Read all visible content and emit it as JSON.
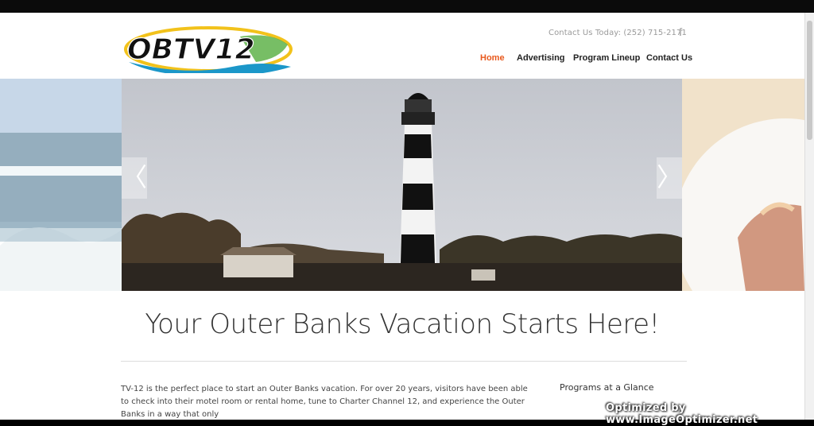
{
  "header": {
    "logo_text": "OBTV12",
    "contact_text": "Contact Us Today: (252) 715-2171",
    "facebook_icon": "facebook-icon",
    "nav": [
      {
        "label": "Home",
        "active": true
      },
      {
        "label": "Advertising",
        "active": false
      },
      {
        "label": "Program Lineup",
        "active": false
      },
      {
        "label": "Contact Us",
        "active": false
      }
    ]
  },
  "slider": {
    "prev_icon": "chevron-left-icon",
    "next_icon": "chevron-right-icon",
    "prev_glyph": "〈",
    "next_glyph": "〉"
  },
  "main": {
    "headline": "Your Outer Banks Vacation Starts Here!",
    "intro": "TV-12 is the perfect place to start an Outer Banks vacation. For over 20 years, visitors have been able to check into their motel room or rental home, tune to Charter Channel 12, and experience the Outer Banks in a way that only",
    "sidebar_title": "Programs at a Glance"
  },
  "watermark": "Optimized by www.ImageOptimizer.net",
  "colors": {
    "accent": "#e8591d",
    "nav_text": "#222222",
    "contact_text": "#9a9a9a"
  }
}
